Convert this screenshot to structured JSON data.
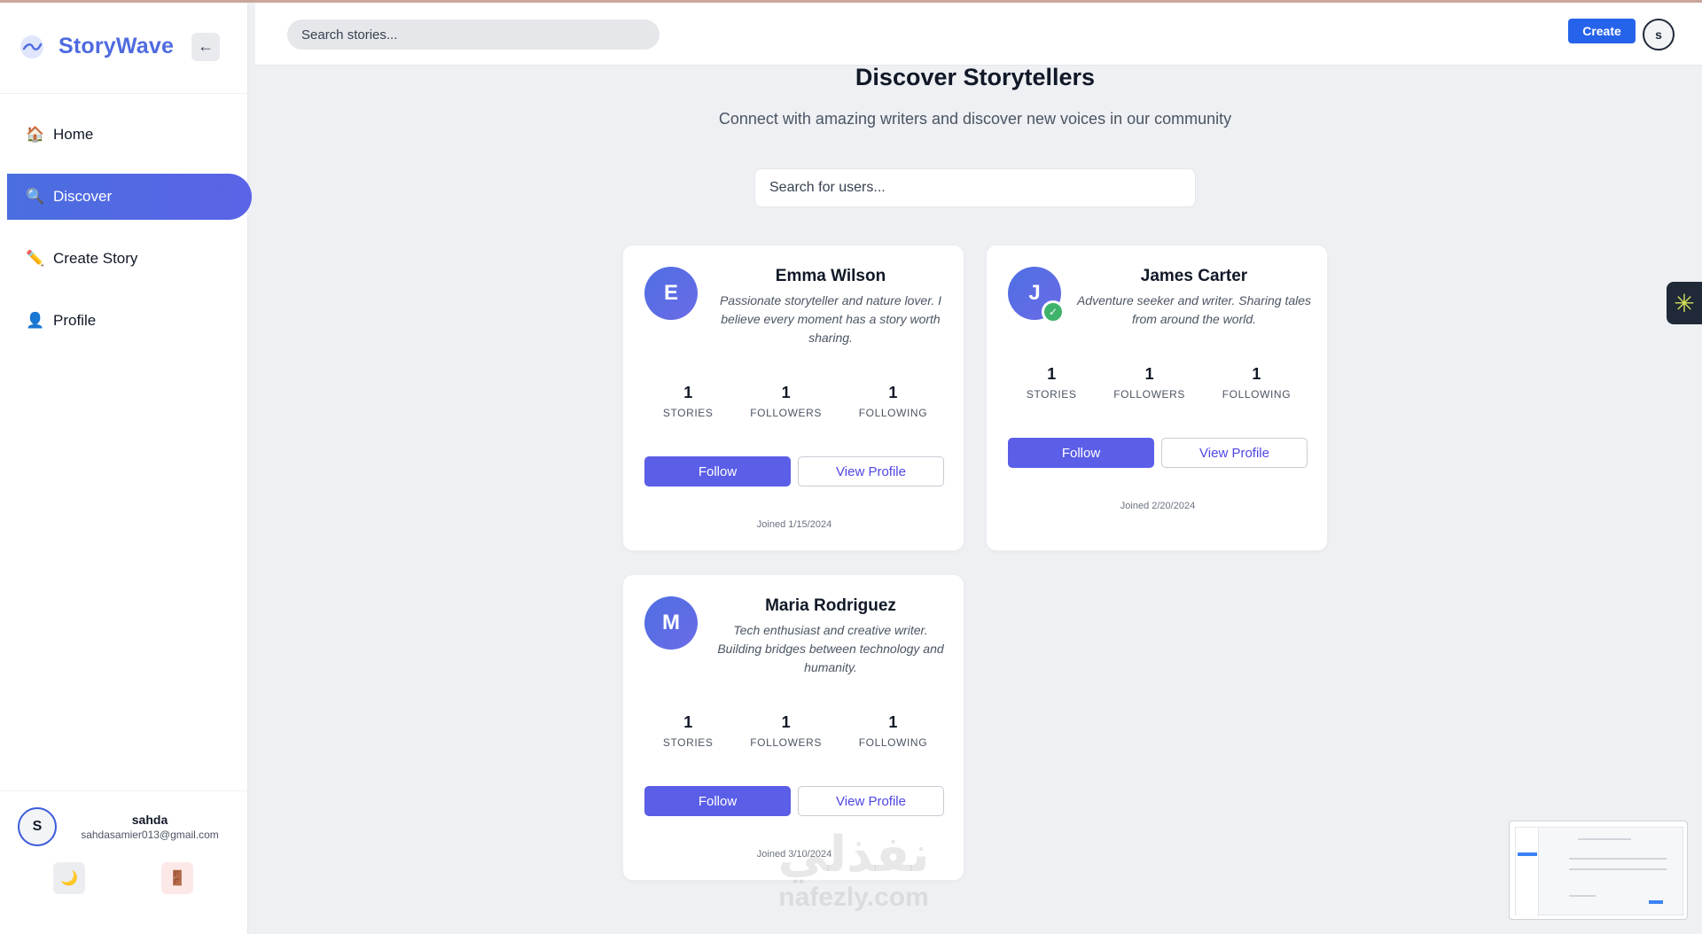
{
  "brand": {
    "name": "StoryWave",
    "collapse_icon": "←"
  },
  "nav": [
    {
      "id": "home",
      "label": "Home",
      "icon": "🏠",
      "active": false
    },
    {
      "id": "discover",
      "label": "Discover",
      "icon": "🔍",
      "active": true
    },
    {
      "id": "create-story",
      "label": "Create Story",
      "icon": "✏️",
      "active": false
    },
    {
      "id": "profile",
      "label": "Profile",
      "icon": "👤",
      "active": false
    }
  ],
  "sidebar_user": {
    "initial": "S",
    "name": "sahda",
    "email": "sahdasamier013@gmail.com",
    "theme_icon": "🌙",
    "logout_icon": "🚪"
  },
  "header": {
    "search_placeholder": "Search stories...",
    "create_label": "Create",
    "avatar_initial": "s"
  },
  "page": {
    "title": "Discover Storytellers",
    "subtitle": "Connect with amazing writers and discover new voices in our community",
    "user_search_placeholder": "Search for users..."
  },
  "stat_labels": {
    "stories": "STORIES",
    "followers": "FOLLOWERS",
    "following": "FOLLOWING"
  },
  "users": [
    {
      "initial": "E",
      "name": "Emma Wilson",
      "verified": false,
      "bio": "Passionate storyteller and nature lover. I believe every moment has a story worth sharing.",
      "stories": "1",
      "followers": "1",
      "following": "1",
      "follow_label": "Follow",
      "view_label": "View Profile",
      "joined": "Joined 1/15/2024"
    },
    {
      "initial": "J",
      "name": "James Carter",
      "verified": true,
      "verified_icon": "✓",
      "bio": "Adventure seeker and writer. Sharing tales from around the world.",
      "stories": "1",
      "followers": "1",
      "following": "1",
      "follow_label": "Follow",
      "view_label": "View Profile",
      "joined": "Joined 2/20/2024"
    },
    {
      "initial": "M",
      "name": "Maria Rodriguez",
      "verified": false,
      "bio": "Tech enthusiast and creative writer. Building bridges between technology and humanity.",
      "stories": "1",
      "followers": "1",
      "following": "1",
      "follow_label": "Follow",
      "view_label": "View Profile",
      "joined": "Joined 3/10/2024"
    }
  ],
  "widget": {
    "icon": "✳"
  },
  "watermark": {
    "arabic": "نفذلي",
    "latin": "nafezly.com"
  }
}
